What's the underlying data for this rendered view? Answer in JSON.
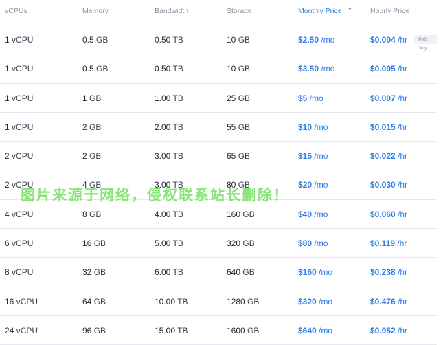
{
  "headers": {
    "vcpus": "vCPUs",
    "memory": "Memory",
    "bandwidth": "Bandwidth",
    "storage": "Storage",
    "monthly": "Monthly Price",
    "hourly": "Hourly Price",
    "sort_icon": "chevron-up-icon"
  },
  "rows": [
    {
      "vcpu_num": "1",
      "vcpu_unit": "vCPU",
      "mem_num": "0.5",
      "mem_unit": "GB",
      "bw_num": "0.50",
      "bw_unit": "TB",
      "st_num": "10",
      "st_unit": "GB",
      "mo_num": "$2.50",
      "mo_unit": "/mo",
      "hr_num": "$0.004",
      "hr_unit": "/hr",
      "badge": "IPv6 Only"
    },
    {
      "vcpu_num": "1",
      "vcpu_unit": "vCPU",
      "mem_num": "0.5",
      "mem_unit": "GB",
      "bw_num": "0.50",
      "bw_unit": "TB",
      "st_num": "10",
      "st_unit": "GB",
      "mo_num": "$3.50",
      "mo_unit": "/mo",
      "hr_num": "$0.005",
      "hr_unit": "/hr"
    },
    {
      "vcpu_num": "1",
      "vcpu_unit": "vCPU",
      "mem_num": "1",
      "mem_unit": "GB",
      "bw_num": "1.00",
      "bw_unit": "TB",
      "st_num": "25",
      "st_unit": "GB",
      "mo_num": "$5",
      "mo_unit": "/mo",
      "hr_num": "$0.007",
      "hr_unit": "/hr"
    },
    {
      "vcpu_num": "1",
      "vcpu_unit": "vCPU",
      "mem_num": "2",
      "mem_unit": "GB",
      "bw_num": "2.00",
      "bw_unit": "TB",
      "st_num": "55",
      "st_unit": "GB",
      "mo_num": "$10",
      "mo_unit": "/mo",
      "hr_num": "$0.015",
      "hr_unit": "/hr"
    },
    {
      "vcpu_num": "2",
      "vcpu_unit": "vCPU",
      "mem_num": "2",
      "mem_unit": "GB",
      "bw_num": "3.00",
      "bw_unit": "TB",
      "st_num": "65",
      "st_unit": "GB",
      "mo_num": "$15",
      "mo_unit": "/mo",
      "hr_num": "$0.022",
      "hr_unit": "/hr"
    },
    {
      "vcpu_num": "2",
      "vcpu_unit": "vCPU",
      "mem_num": "4",
      "mem_unit": "GB",
      "bw_num": "3.00",
      "bw_unit": "TB",
      "st_num": "80",
      "st_unit": "GB",
      "mo_num": "$20",
      "mo_unit": "/mo",
      "hr_num": "$0.030",
      "hr_unit": "/hr"
    },
    {
      "vcpu_num": "4",
      "vcpu_unit": "vCPU",
      "mem_num": "8",
      "mem_unit": "GB",
      "bw_num": "4.00",
      "bw_unit": "TB",
      "st_num": "160",
      "st_unit": "GB",
      "mo_num": "$40",
      "mo_unit": "/mo",
      "hr_num": "$0.060",
      "hr_unit": "/hr"
    },
    {
      "vcpu_num": "6",
      "vcpu_unit": "vCPU",
      "mem_num": "16",
      "mem_unit": "GB",
      "bw_num": "5.00",
      "bw_unit": "TB",
      "st_num": "320",
      "st_unit": "GB",
      "mo_num": "$80",
      "mo_unit": "/mo",
      "hr_num": "$0.119",
      "hr_unit": "/hr"
    },
    {
      "vcpu_num": "8",
      "vcpu_unit": "vCPU",
      "mem_num": "32",
      "mem_unit": "GB",
      "bw_num": "6.00",
      "bw_unit": "TB",
      "st_num": "640",
      "st_unit": "GB",
      "mo_num": "$160",
      "mo_unit": "/mo",
      "hr_num": "$0.238",
      "hr_unit": "/hr"
    },
    {
      "vcpu_num": "16",
      "vcpu_unit": "vCPU",
      "mem_num": "64",
      "mem_unit": "GB",
      "bw_num": "10.00",
      "bw_unit": "TB",
      "st_num": "1280",
      "st_unit": "GB",
      "mo_num": "$320",
      "mo_unit": "/mo",
      "hr_num": "$0.476",
      "hr_unit": "/hr"
    },
    {
      "vcpu_num": "24",
      "vcpu_unit": "vCPU",
      "mem_num": "96",
      "mem_unit": "GB",
      "bw_num": "15.00",
      "bw_unit": "TB",
      "st_num": "1600",
      "st_unit": "GB",
      "mo_num": "$640",
      "mo_unit": "/mo",
      "hr_num": "$0.952",
      "hr_unit": "/hr"
    }
  ],
  "watermark": "图片来源于网络，侵权联系站长删除！",
  "colors": {
    "accent": "#2e7ce8",
    "header_text": "#8c93a1",
    "divider": "#e6e9ef",
    "watermark": "#7ee06c"
  }
}
